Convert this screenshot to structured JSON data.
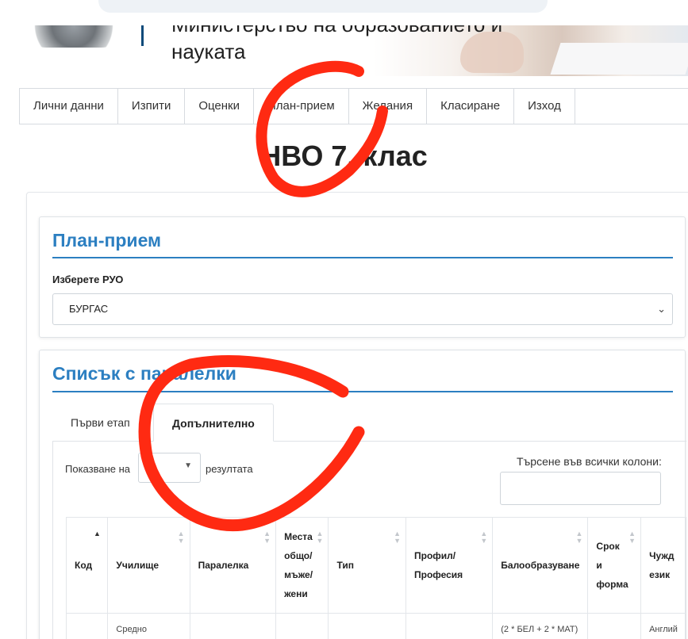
{
  "header": {
    "ministry_line1": "Министерство на образованието и",
    "ministry_line2": "науката"
  },
  "nav": {
    "items": [
      "Лични данни",
      "Изпити",
      "Оценки",
      "План-прием",
      "Желания",
      "Класиране",
      "Изход"
    ]
  },
  "page_title": "НВО 7. клас",
  "plan": {
    "title": "План-прием",
    "rio_label": "Изберете РУО",
    "rio_value": "БУРГАС"
  },
  "list": {
    "title": "Списък с паралелки",
    "tabs": [
      "Първи етап",
      "Допълнително"
    ],
    "active_tab": "Допълнително",
    "show_prefix": "Показване на",
    "show_value": "",
    "show_suffix": "резултата",
    "search_label": "Търсене във всички колони:",
    "search_value": "",
    "columns": [
      {
        "lines": [
          "Код"
        ]
      },
      {
        "lines": [
          "Училище"
        ]
      },
      {
        "lines": [
          "Паралелка"
        ]
      },
      {
        "lines": [
          "Места",
          "общо/",
          "мъже/",
          "жени"
        ]
      },
      {
        "lines": [
          "Тип"
        ]
      },
      {
        "lines": [
          "Профил/",
          "Професия"
        ]
      },
      {
        "lines": [
          "Балообразуване"
        ]
      },
      {
        "lines": [
          "Срок",
          "и",
          "форма"
        ]
      },
      {
        "lines": [
          "Чужд",
          "език"
        ]
      }
    ],
    "first_row": [
      "",
      "Средно",
      "",
      "",
      "",
      "",
      "(2 * БЕЛ + 2 * МАТ)",
      "",
      "Англий"
    ]
  },
  "colors": {
    "accent": "#2c7fc1",
    "scribble": "#ff2a12"
  }
}
